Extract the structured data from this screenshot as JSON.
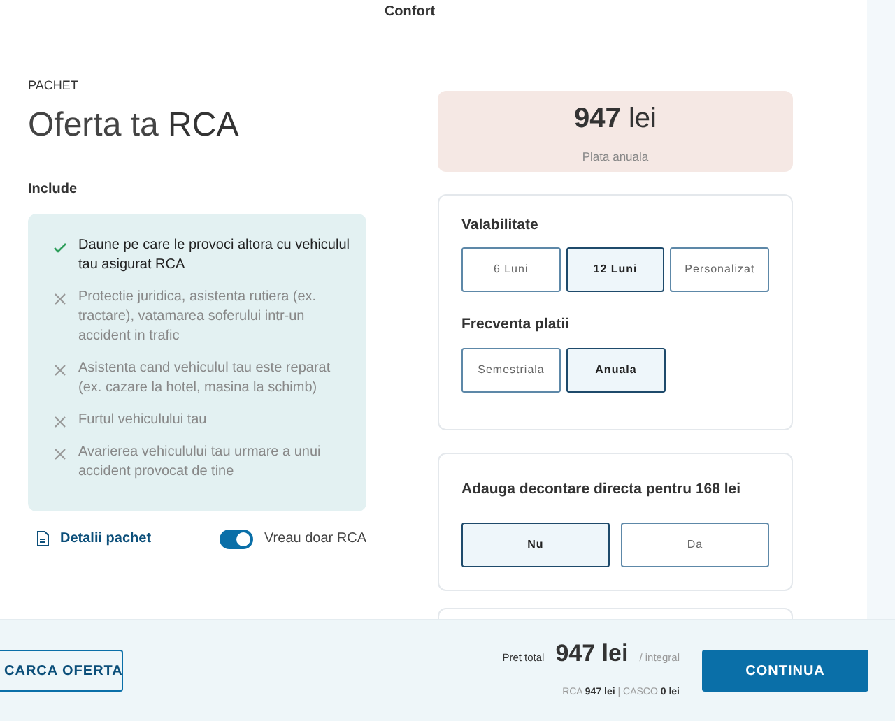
{
  "header": {
    "title": "Confort"
  },
  "package": {
    "eyebrow": "PACHET",
    "title": "Oferta ta **RCA**",
    "include_label": "Include",
    "coverage": [
      {
        "text": "Daune pe care le provoci altora cu vehiculul tau asigurat RCA",
        "included": true
      },
      {
        "text": "Protectie juridica, asistenta rutiera (ex. tractare), vatamarea soferului intr-un accident in trafic",
        "included": false
      },
      {
        "text": "Asistenta cand vehiculul tau este reparat (ex. cazare la hotel, masina la schimb)",
        "included": false
      },
      {
        "text": "Furtul vehiculului tau",
        "included": false
      },
      {
        "text": "Avarierea vehiculului tau urmare a unui accident provocat de tine",
        "included": false
      }
    ],
    "details_link": "Detalii pachet",
    "rca_only": {
      "label": "Vreau doar RCA",
      "on": true
    }
  },
  "price_box": {
    "amount": "947",
    "unit": "lei",
    "caption": "Plata anuala"
  },
  "validity": {
    "label": "Valabilitate",
    "options": [
      {
        "label": "6 Luni",
        "selected": false
      },
      {
        "label": "12 Luni",
        "selected": true
      },
      {
        "label": "Personalizat",
        "selected": false
      }
    ]
  },
  "frequency": {
    "label": "Frecventa platii",
    "options": [
      {
        "label": "Semestriala",
        "selected": false
      },
      {
        "label": "Anuala",
        "selected": true
      }
    ]
  },
  "direct_settlement": {
    "label": "Adauga decontare directa pentru 168 lei",
    "options": [
      {
        "label": "Nu",
        "selected": true
      },
      {
        "label": "Da",
        "selected": false
      }
    ]
  },
  "footer": {
    "secondary_button": "CARCA OFERTA",
    "total_label": "Pret total",
    "total_amount": "947 lei",
    "total_suffix": "/ integral",
    "breakdown": "RCA **947 lei** | CASCO **0 lei**",
    "primary_button": "CONTINUA"
  }
}
